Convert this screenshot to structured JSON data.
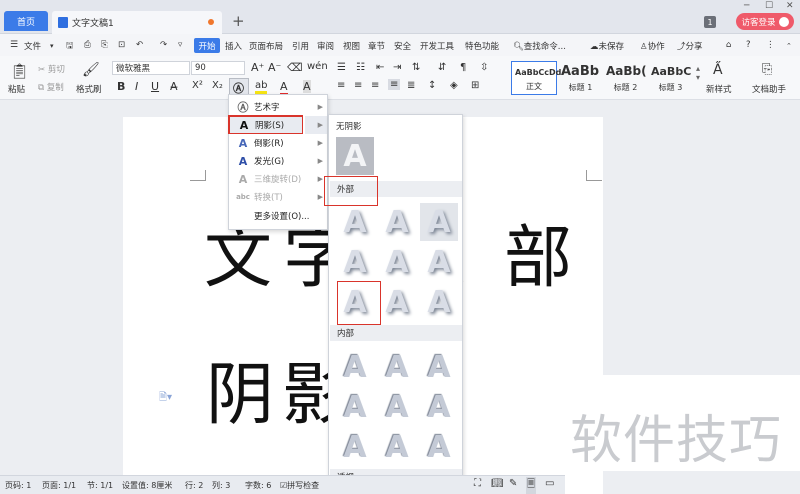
{
  "titlebar": {
    "home_tab": "首页",
    "doc_tab": "文字文稿1",
    "new_tab": "+",
    "badge": "1",
    "guest_login": "访客登录"
  },
  "menu": {
    "file": "文件",
    "items": [
      "开始",
      "插入",
      "页面布局",
      "引用",
      "审阅",
      "视图",
      "章节",
      "安全",
      "开发工具",
      "特色功能"
    ],
    "search": "查找命令...",
    "unsaved": "未保存",
    "collab": "协作",
    "share": "分享",
    "help": "?"
  },
  "ribbon": {
    "paste": "粘贴",
    "cut": "剪切",
    "copy": "复制",
    "format_painter": "格式刷",
    "font_name": "微软雅黑",
    "font_size": "90",
    "bold": "B",
    "italic": "I",
    "underline": "U",
    "styles": [
      {
        "preview": "AaBbCcDd",
        "label": "正文"
      },
      {
        "preview": "AaBb",
        "label": "标题 1"
      },
      {
        "preview": "AaBb(",
        "label": "标题 2"
      },
      {
        "preview": "AaBbC",
        "label": "标题 3"
      }
    ],
    "new_style": "新样式",
    "doc_assistant": "文档助手"
  },
  "document": {
    "line1": [
      "文",
      "字",
      "、",
      "部"
    ],
    "line2": [
      "阴",
      "影"
    ]
  },
  "watermark": "软件技巧",
  "dropdown": {
    "items": [
      {
        "label": "艺术字",
        "icon": "A",
        "disabled": false
      },
      {
        "label": "阴影(S)",
        "icon": "A",
        "disabled": false
      },
      {
        "label": "倒影(R)",
        "icon": "A",
        "disabled": false
      },
      {
        "label": "发光(G)",
        "icon": "A",
        "disabled": false
      },
      {
        "label": "三维旋转(D)",
        "icon": "A",
        "disabled": true
      },
      {
        "label": "转换(T)",
        "icon": "abc",
        "disabled": true
      },
      {
        "label": "更多设置(O)...",
        "icon": "",
        "disabled": false
      }
    ]
  },
  "submenu": {
    "no_shadow": "无阴影",
    "outer": "外部",
    "inner": "内部",
    "perspective": "透视",
    "glyph": "A"
  },
  "statusbar": {
    "page_code": "页码: 1",
    "page": "页面: 1/1",
    "section": "节: 1/1",
    "setting": "设置值: 8厘米",
    "row": "行: 2",
    "col": "列: 3",
    "words": "字数: 6",
    "spell": "拼写检查"
  },
  "colors": {
    "accent": "#3b7be8",
    "highlight_red": "#d9342b",
    "guest_pink": "#ef5a6a"
  }
}
